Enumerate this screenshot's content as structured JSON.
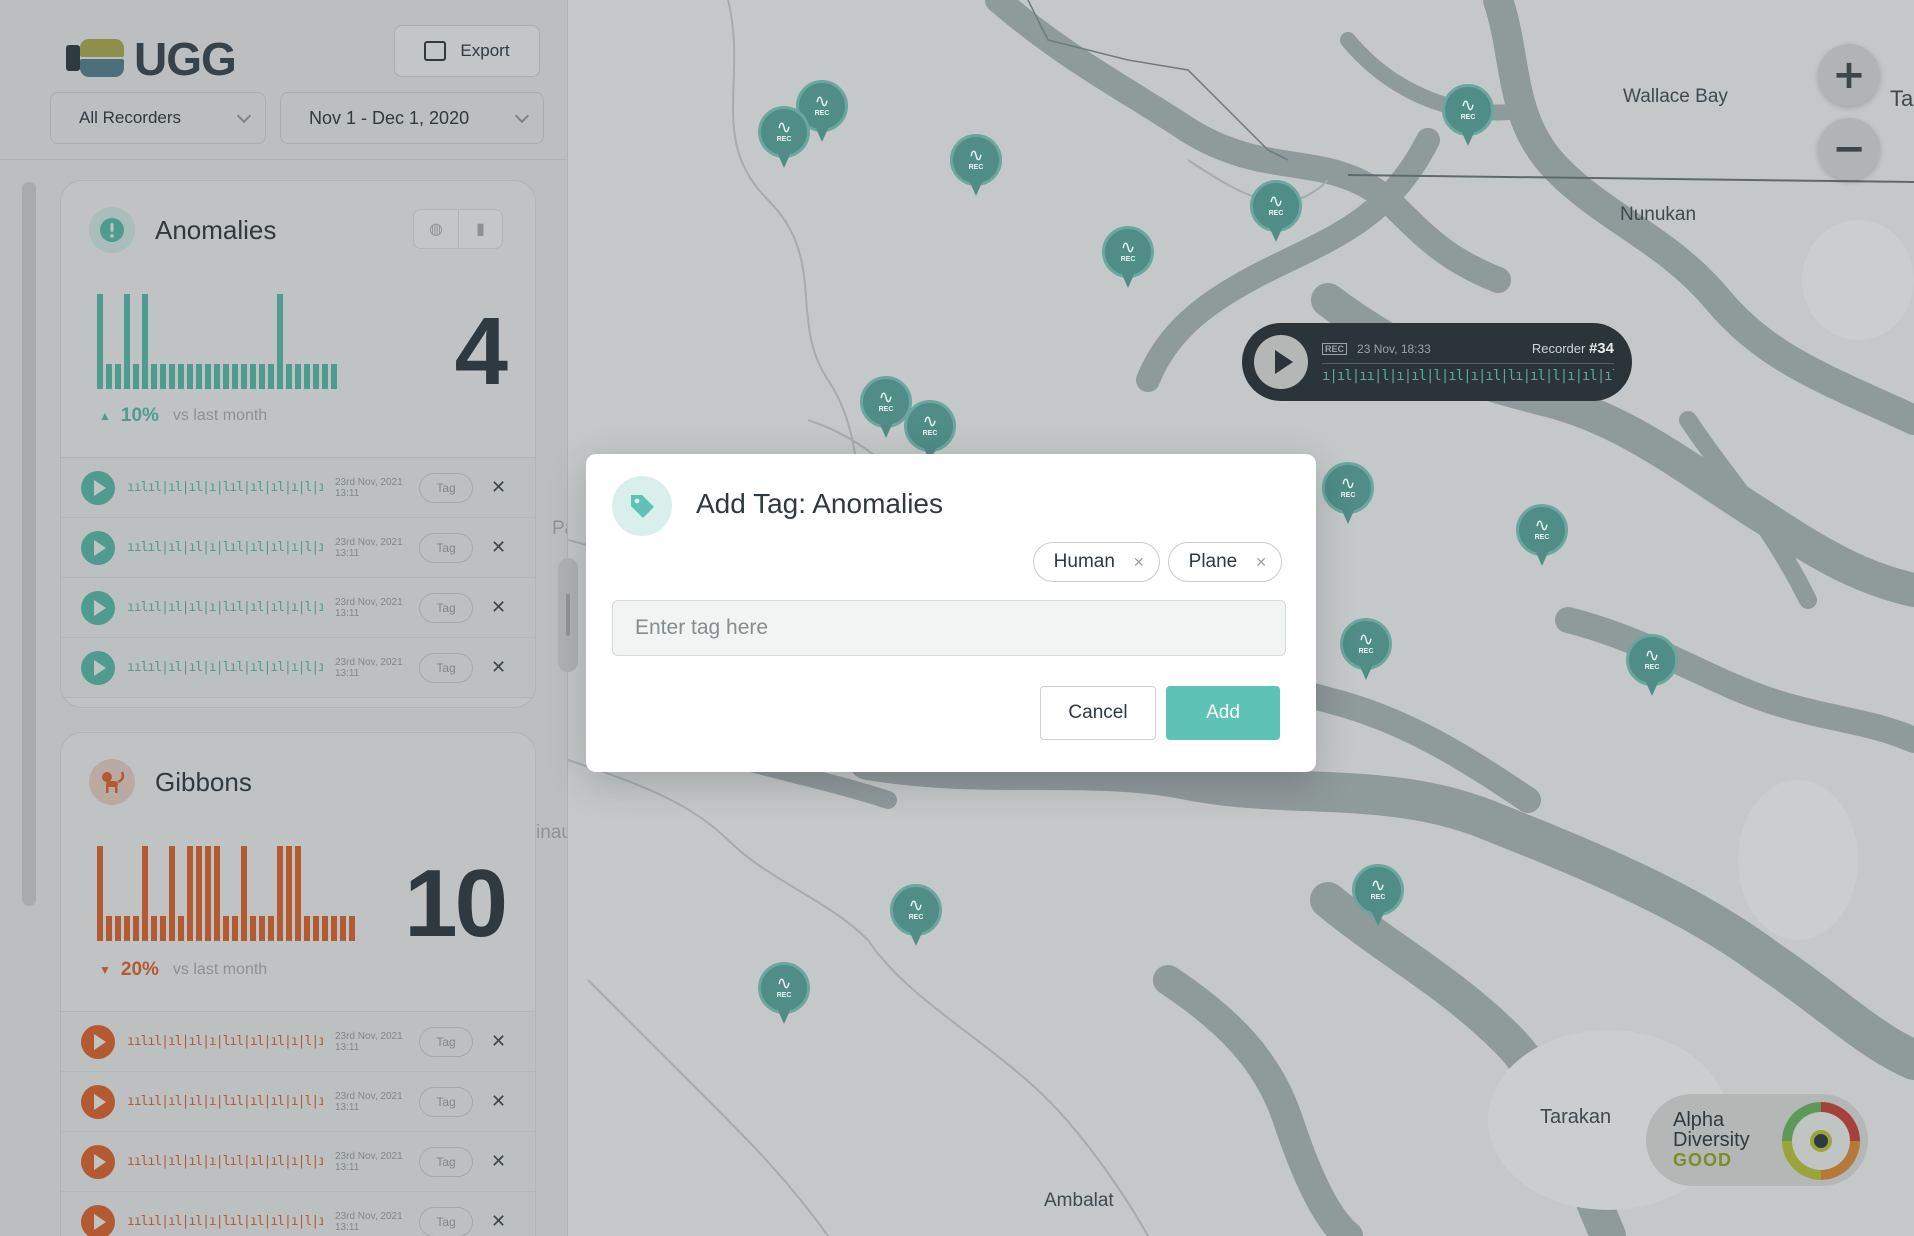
{
  "app": {
    "logo_text": "UGG"
  },
  "toolbar": {
    "export_label": "Export",
    "recorder_filter": "All Recorders",
    "date_range": "Nov 1 - Dec 1, 2020"
  },
  "colors": {
    "teal": "#5ec2b6",
    "anomalies": "#4f9c8e",
    "gibbons": "#b35a33",
    "dark": "#2e3a40"
  },
  "cards": {
    "anomalies": {
      "title": "Anomalies",
      "count": "4",
      "delta": "10%",
      "delta_direction": "up",
      "delta_suffix": "vs last month",
      "icon": "alert-icon",
      "bars": [
        0.95,
        0.25,
        0.25,
        0.95,
        0.25,
        0.95,
        0.25,
        0.25,
        0.25,
        0.25,
        0.25,
        0.25,
        0.25,
        0.25,
        0.25,
        0.25,
        0.25,
        0.25,
        0.25,
        0.25,
        0.95,
        0.25,
        0.25,
        0.25,
        0.25,
        0.25,
        0.25
      ],
      "recordings": [
        {
          "date": "23rd Nov, 2021",
          "time": "13:11",
          "tag_label": "Tag"
        },
        {
          "date": "23rd Nov, 2021",
          "time": "13:11",
          "tag_label": "Tag"
        },
        {
          "date": "23rd Nov, 2021",
          "time": "13:11",
          "tag_label": "Tag"
        },
        {
          "date": "23rd Nov, 2021",
          "time": "13:11",
          "tag_label": "Tag"
        }
      ]
    },
    "gibbons": {
      "title": "Gibbons",
      "count": "10",
      "delta": "20%",
      "delta_direction": "down",
      "delta_suffix": "vs last month",
      "icon": "monkey-icon",
      "bars": [
        0.95,
        0.25,
        0.25,
        0.25,
        0.25,
        0.95,
        0.25,
        0.25,
        0.95,
        0.25,
        0.95,
        0.95,
        0.95,
        0.95,
        0.25,
        0.25,
        0.95,
        0.25,
        0.25,
        0.25,
        0.95,
        0.95,
        0.95,
        0.25,
        0.25,
        0.25,
        0.25,
        0.25,
        0.25
      ],
      "recordings": [
        {
          "date": "23rd Nov, 2021",
          "time": "13:11",
          "tag_label": "Tag"
        },
        {
          "date": "23rd Nov, 2021",
          "time": "13:11",
          "tag_label": "Tag"
        },
        {
          "date": "23rd Nov, 2021",
          "time": "13:11",
          "tag_label": "Tag"
        },
        {
          "date": "23rd Nov, 2021",
          "time": "13:11",
          "tag_label": "Tag"
        }
      ]
    }
  },
  "map": {
    "labels": [
      "Wallace Bay",
      "Nunukan",
      "Tarakan",
      "Ambalat",
      "Ta",
      "Pad",
      "inau"
    ],
    "zoom_in": "+",
    "zoom_out": "−",
    "pin_rec_label": "REC",
    "player": {
      "rec_badge": "REC",
      "datetime": "23 Nov, 18:33",
      "recorder_prefix": "Recorder",
      "recorder_id": "#34"
    },
    "alpha": {
      "line1": "Alpha",
      "line2": "Diversity",
      "status": "GOOD"
    }
  },
  "modal": {
    "title": "Add Tag: Anomalies",
    "icon": "tag-icon",
    "tags": [
      "Human",
      "Plane"
    ],
    "input_placeholder": "Enter tag here",
    "input_value": "",
    "cancel_label": "Cancel",
    "add_label": "Add"
  }
}
